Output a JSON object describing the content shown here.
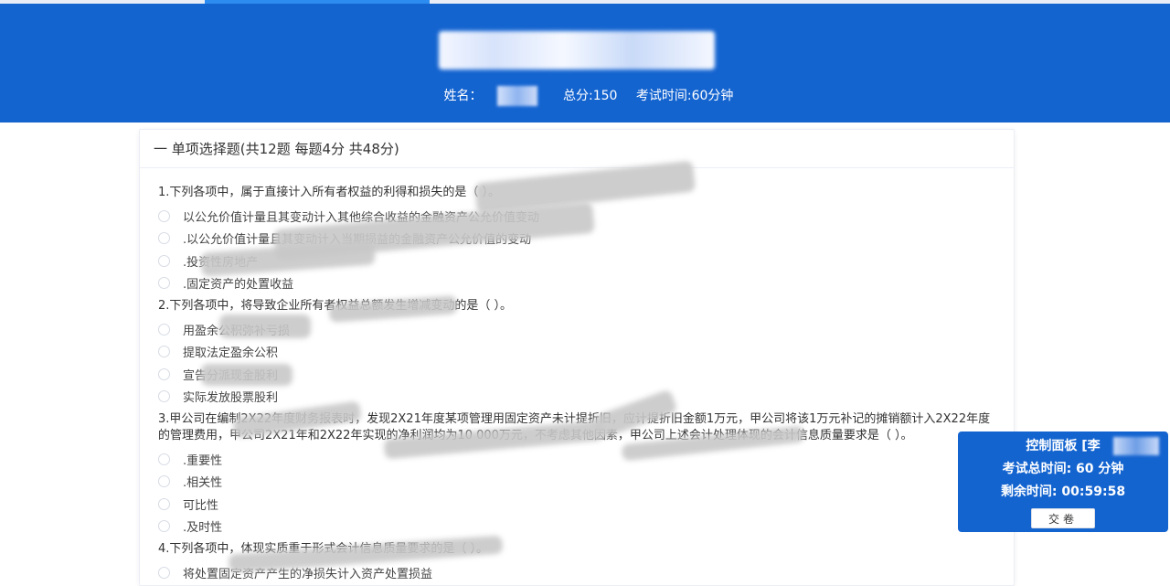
{
  "header": {
    "title": "2021",
    "name_label": "姓名：",
    "total_score": "总分:150",
    "exam_time": "考试时间:60分钟"
  },
  "section": {
    "title": "一 单项选择题(共12题 每题4分 共48分)"
  },
  "questions": [
    {
      "stem": "1.下列各项中，属于直接计入所有者权益的利得和损失的是（    ）。",
      "options": [
        "以公允价值计量且其变动计入其他综合收益的金融资产公允价值变动",
        ".以公允价值计量且其变动计入当期损益的金融资产公允价值的变动",
        ".投资性房地产",
        ".固定资产的处置收益"
      ]
    },
    {
      "stem": "2.下列各项中，将导致企业所有者权益总额发生增减变动的是（    ）。",
      "options": [
        "用盈余公积弥补亏损",
        "提取法定盈余公积",
        "宣告分派现金股利",
        "实际发放股票股利"
      ]
    },
    {
      "stem": "3.甲公司在编制2X22年度财务报表时，发现2X21年度某项管理用固定资产未计提折旧，应计提折旧金额1万元，甲公司将该1万元补记的摊销额计入2X22年度的管理费用，甲公司2X21年和2X22年实现的净利润均为10 000万元，不考虑其他因素，甲公司上述会计处理体现的会计信息质量要求是（    ）。",
      "options": [
        ".重要性",
        ".相关性",
        "可比性",
        ".及时性"
      ]
    },
    {
      "stem": "4.下列各项中，体现实质重于形式会计信息质量要求的是（    ）。",
      "options": [
        "将处置固定资产产生的净损失计入资产处置损益"
      ]
    }
  ],
  "control_panel": {
    "title": "控制面板 [李",
    "total_time": "考试总时间: 60 分钟",
    "remaining_time": "剩余时间: 00:59:58",
    "submit_label": "交卷"
  },
  "colors": {
    "header_bg": "#1464d0",
    "progress_fill": "#2d8cf0",
    "panel_bg": "#1464d0"
  }
}
